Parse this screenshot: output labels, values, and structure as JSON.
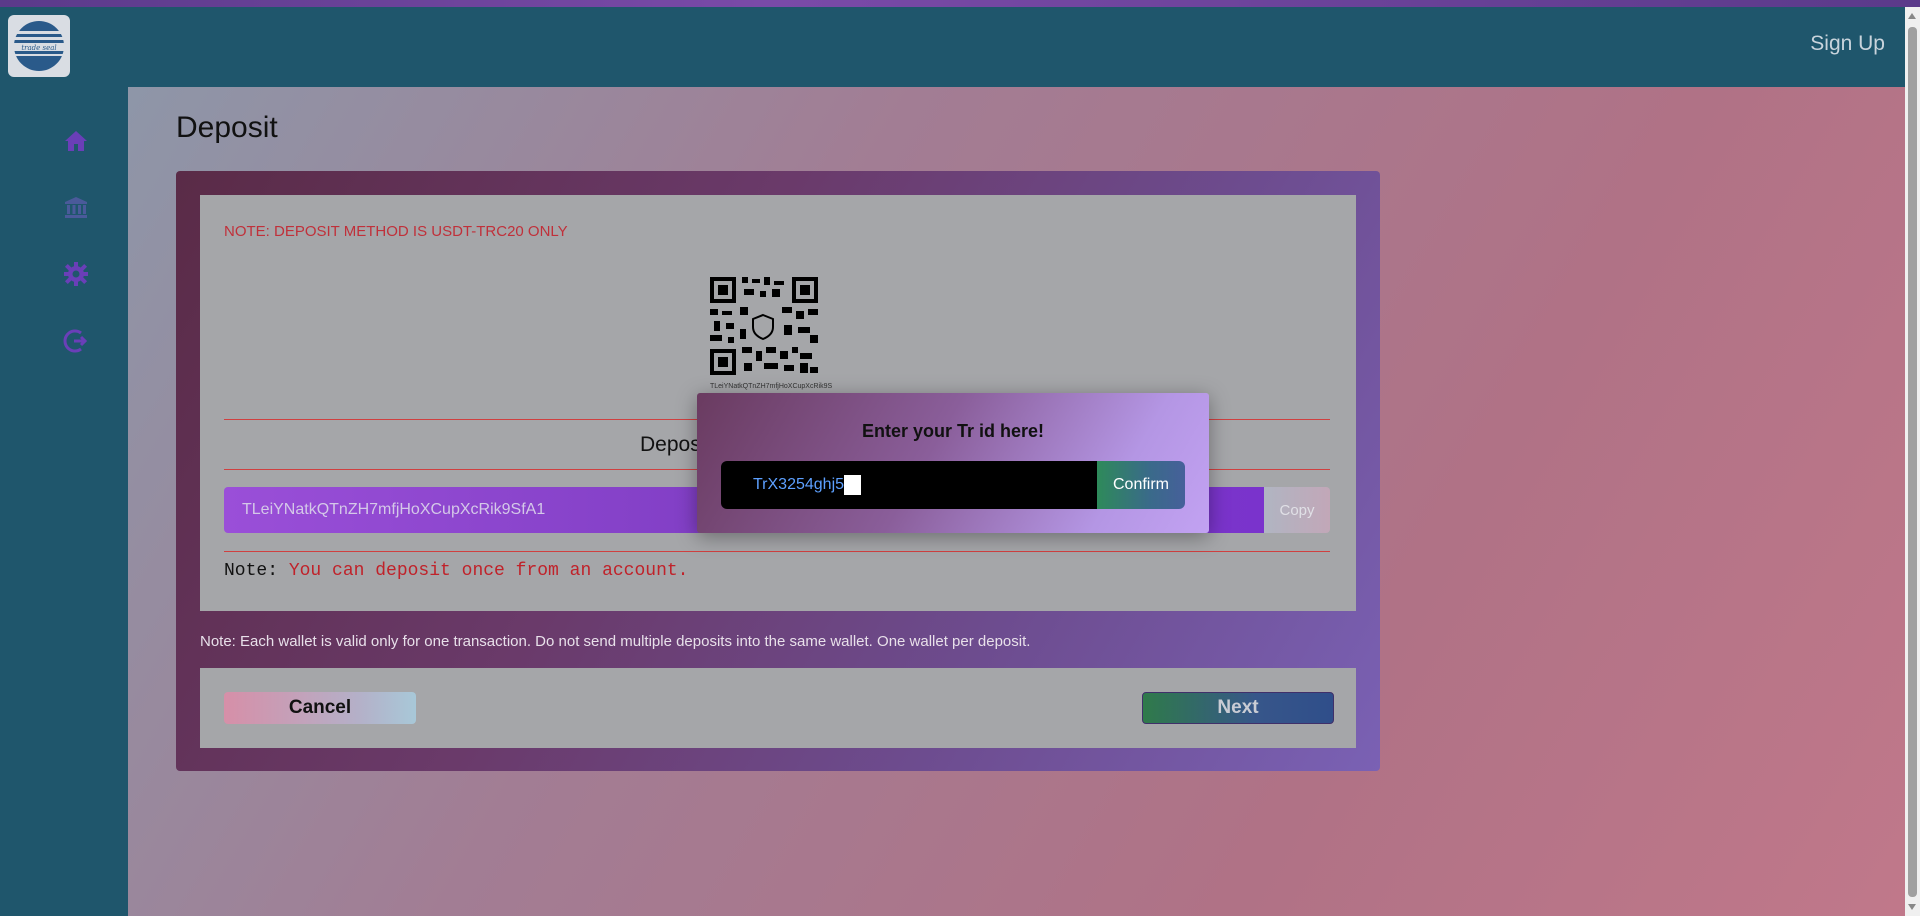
{
  "header": {
    "logo_text": "trade seal",
    "signup_label": "Sign Up"
  },
  "sidebar": {
    "items": [
      {
        "icon": "home-icon"
      },
      {
        "icon": "bank-icon"
      },
      {
        "icon": "gear-icon"
      },
      {
        "icon": "logout-icon"
      }
    ]
  },
  "page": {
    "title": "Deposit"
  },
  "deposit": {
    "method_note": "NOTE: DEPOSIT METHOD IS USDT-TRC20 ONLY",
    "qr_caption": "TLeiYNatkQTnZH7mfjHoXCupXcRik9S",
    "deposit_label": "Deposit",
    "address": "TLeiYNatkQTnZH7mfjHoXCupXcRik9SfA1",
    "copy_label": "Copy",
    "note_prefix": "Note: ",
    "note_text": "You can deposit once from an account.",
    "wallet_note": "Note: Each wallet is valid only for one transaction. Do not send multiple deposits into the same wallet. One wallet per deposit.",
    "cancel_label": "Cancel",
    "next_label": "Next"
  },
  "modal": {
    "title": "Enter your Tr id here!",
    "input_value": "TrX3254ghj5",
    "confirm_label": "Confirm"
  },
  "colors": {
    "header_bg": "#1f566c",
    "note_red": "#c0303a",
    "address_purple": "#9a4fd8"
  }
}
